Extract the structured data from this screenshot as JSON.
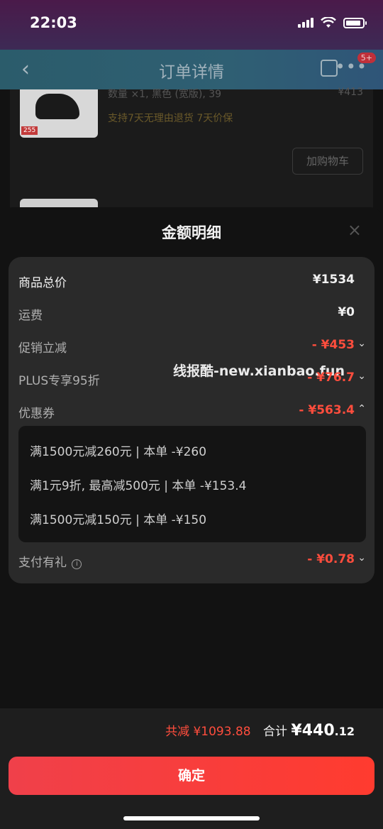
{
  "status_bar": {
    "time": "22:03"
  },
  "nav": {
    "back": "‹",
    "title": "订单详情",
    "more": "•••",
    "badge": "5+"
  },
  "background": {
    "item_spec": "数量 ×1, 黑色 (宽版), 39",
    "item_price": "¥413",
    "item_policy": "支持7天无理由退货   7天价保",
    "add_cart": "加购物车",
    "thumb_tag": "255"
  },
  "sheet": {
    "title": "金额明细",
    "close": "×",
    "watermark": "线报酷-new.xianbao.fun",
    "rows": {
      "total": {
        "label": "商品总价",
        "amount": "¥1534"
      },
      "shipping": {
        "label": "运费",
        "amount": "¥0"
      },
      "promo": {
        "label": "促销立减",
        "amount": "- ¥453"
      },
      "plus": {
        "label": "PLUS专享95折",
        "amount": "- ¥76.7"
      },
      "coupon": {
        "label": "优惠券",
        "amount": "- ¥563.4"
      },
      "pay_gift": {
        "label": "支付有礼",
        "amount": "- ¥0.78"
      }
    },
    "coupons": [
      "满1500元减260元 | 本单 -¥260",
      "满1元9折, 最高减500元 | 本单 -¥153.4",
      "满1500元减150元 | 本单 -¥150"
    ]
  },
  "footer": {
    "saved_label": "共减",
    "saved_amount": "¥1093.88",
    "total_label": "合计",
    "total_int": "¥440",
    "total_dec": ".12",
    "confirm": "确定"
  },
  "colors": {
    "accent": "#ff4d3d",
    "button": "#ff3b2f"
  }
}
